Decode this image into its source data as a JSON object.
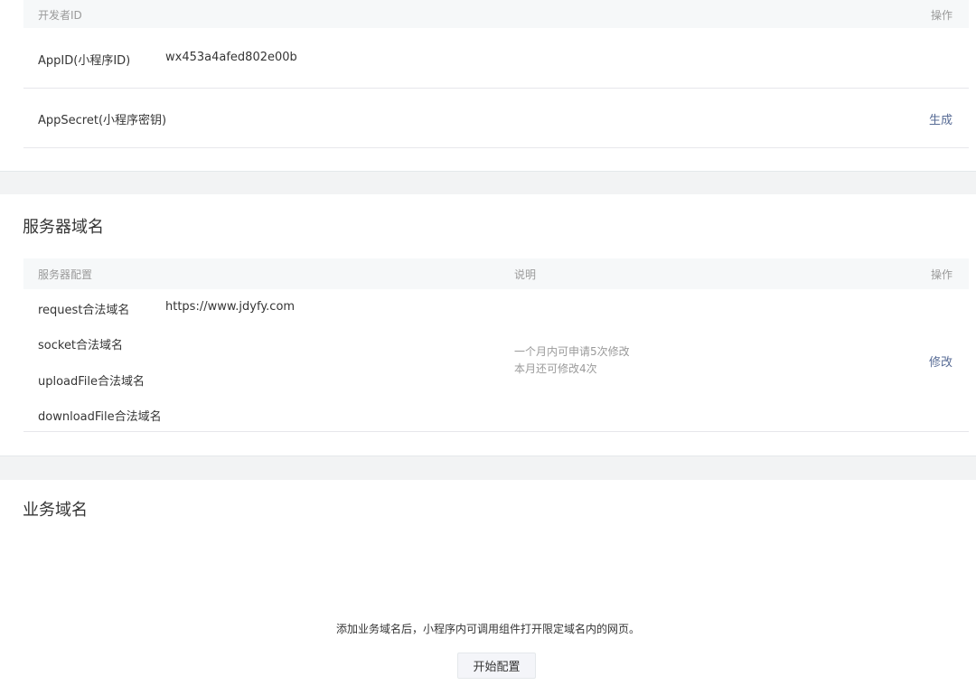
{
  "developer_id": {
    "header": {
      "col_name": "开发者ID",
      "col_action": "操作"
    },
    "rows": [
      {
        "label": "AppID(小程序ID)",
        "value": "wx453a4afed802e00b",
        "action": ""
      },
      {
        "label": "AppSecret(小程序密钥)",
        "value": "",
        "action": "生成"
      }
    ]
  },
  "server_domain": {
    "title": "服务器域名",
    "header": {
      "col_config": "服务器配置",
      "col_desc": "说明",
      "col_action": "操作"
    },
    "items": [
      {
        "label": "request合法域名",
        "value": "https://www.jdyfy.com"
      },
      {
        "label": "socket合法域名",
        "value": ""
      },
      {
        "label": "uploadFile合法域名",
        "value": ""
      },
      {
        "label": "downloadFile合法域名",
        "value": ""
      }
    ],
    "desc_line1": "一个月内可申请5次修改",
    "desc_line2": "本月还可修改4次",
    "action": "修改"
  },
  "business_domain": {
    "title": "业务域名",
    "empty_text": "添加业务域名后，小程序内可调用组件打开限定域名内的网页。",
    "button": "开始配置"
  }
}
